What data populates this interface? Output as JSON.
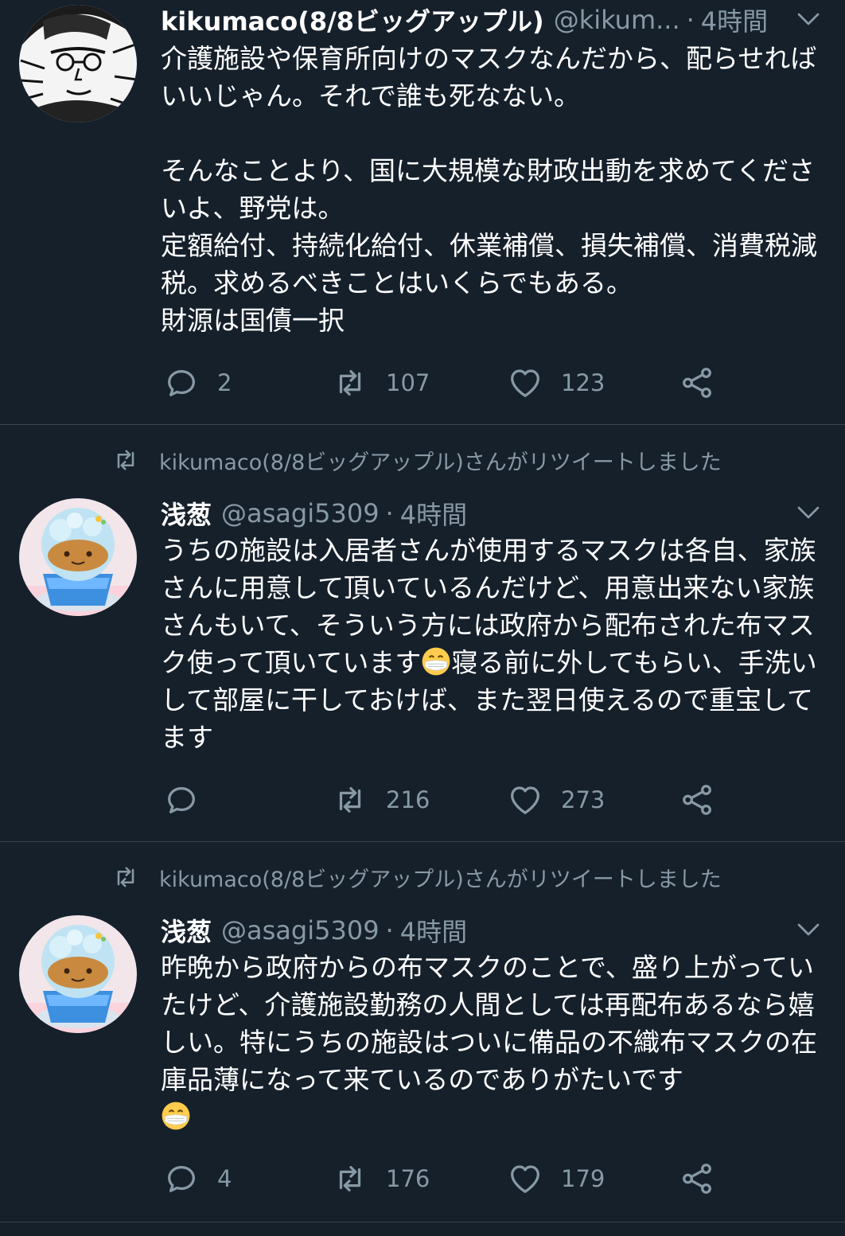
{
  "colors": {
    "background": "#15202b",
    "text_primary": "#ffffff",
    "text_secondary": "#8899a6",
    "divider": "#38444d"
  },
  "tweets": [
    {
      "name": "kikumaco(8/8ビッグアップル)",
      "handle": "@kikum...",
      "separator": "·",
      "time": "4時間",
      "text": "介護施設や保育所向けのマスクなんだから、配らせればいいじゃん。それで誰も死なない。\n\nそんなことより、国に大規模な財政出動を求めてくださいよ、野党は。\n定額給付、持続化給付、休業補償、損失補償、消費税減税。求めるべきことはいくらでもある。\n財源は国債一択",
      "replies": "2",
      "retweets": "107",
      "likes": "123"
    },
    {
      "retweeted_by": "kikumaco(8/8ビッグアップル)さんがリツイートしました",
      "name": "浅葱",
      "handle": "@asagi5309",
      "separator": "·",
      "time": "4時間",
      "text_part1": "うちの施設は入居者さんが使用するマスクは各自、家族さんに用意して頂いているんだけど、用意出来ない家族さんもいて、そういう方には政府から配布された布マスク使って頂いています",
      "text_part2": "寝る前に外してもらい、手洗いして部屋に干しておけば、また翌日使えるので重宝してます",
      "replies": "",
      "retweets": "216",
      "likes": "273",
      "emoji": "mask-face-emoji"
    },
    {
      "retweeted_by": "kikumaco(8/8ビッグアップル)さんがリツイートしました",
      "name": "浅葱",
      "handle": "@asagi5309",
      "separator": "·",
      "time": "4時間",
      "text": "昨晩から政府からの布マスクのことで、盛り上がっていたけど、介護施設勤務の人間としては再配布あるなら嬉しい。特にうちの施設はついに備品の不織布マスクの在庫品薄になって来ているのでありがたいです",
      "replies": "4",
      "retweets": "176",
      "likes": "179",
      "emoji": "mask-face-emoji"
    }
  ],
  "icons": {
    "reply": "reply-icon",
    "retweet": "retweet-icon",
    "like": "heart-icon",
    "share": "share-icon",
    "menu": "chevron-down-icon"
  }
}
